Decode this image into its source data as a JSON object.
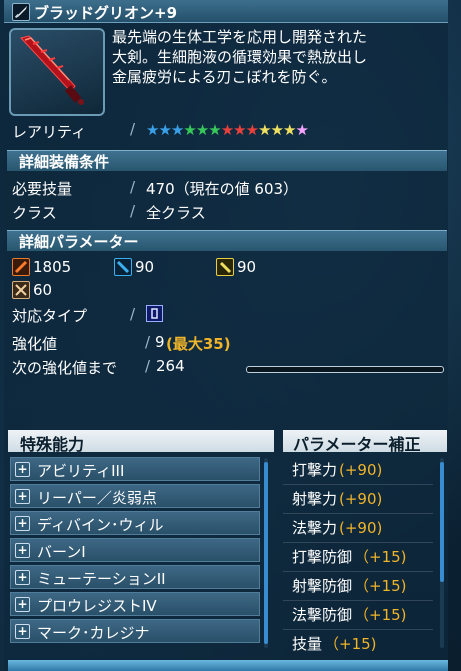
{
  "title": "ブラッドグリオン+9",
  "description": "最先端の生体工学を応用し開発された\n大剣。生細胞液の循環効果で熱放出し\n金属疲労による刃こぼれを防ぐ。",
  "rarity": {
    "label": "レアリティ",
    "stars": [
      {
        "char": "★",
        "color": "#3aa0e8"
      },
      {
        "char": "★",
        "color": "#3aa0e8"
      },
      {
        "char": "★",
        "color": "#3aa0e8"
      },
      {
        "char": "★",
        "color": "#38c85a"
      },
      {
        "char": "★",
        "color": "#38c85a"
      },
      {
        "char": "★",
        "color": "#38c85a"
      },
      {
        "char": "★",
        "color": "#e8403a"
      },
      {
        "char": "★",
        "color": "#e8403a"
      },
      {
        "char": "★",
        "color": "#e8403a"
      },
      {
        "char": "★",
        "color": "#f0e060"
      },
      {
        "char": "★",
        "color": "#f0e060"
      },
      {
        "char": "★",
        "color": "#f0e060"
      },
      {
        "char": "★",
        "color": "#f6a2ff"
      }
    ]
  },
  "equip_conditions": {
    "header": "詳細装備条件",
    "skill_label": "必要技量",
    "skill_value": "470（現在の値 603）",
    "class_label": "クラス",
    "class_value": "全クラス"
  },
  "parameters": {
    "header": "詳細パラメーター",
    "atk_melee": "1805",
    "atk_ranged": "90",
    "atk_tech": "90",
    "dex": "60",
    "type_label": "対応タイプ",
    "grind_label": "強化値",
    "grind_value": "9",
    "grind_max": "(最大35)",
    "next_label": "次の強化値まで",
    "next_value": "264",
    "next_progress_fraction": 0.0
  },
  "special_abilities": {
    "header": "特殊能力",
    "items": [
      "アビリティIII",
      "リーパー／炎弱点",
      "ディバイン･ウィル",
      "バーンI",
      "ミューテーションII",
      "プロウレジストIV",
      "マーク･カレジナ"
    ]
  },
  "parameter_bonus": {
    "header": "パラメーター補正",
    "items": [
      {
        "label": "打撃力",
        "value": "(+90)"
      },
      {
        "label": "射撃力",
        "value": "(+90)"
      },
      {
        "label": "法撃力",
        "value": "(+90)"
      },
      {
        "label": "打撃防御",
        "value": "（+15)"
      },
      {
        "label": "射撃防御",
        "value": "（+15)"
      },
      {
        "label": "法撃防御",
        "value": "（+15)"
      },
      {
        "label": "技量",
        "value": "（+15)"
      }
    ]
  },
  "colors": {
    "accent_gold": "#f0b429",
    "header_blue": "#3f7290"
  }
}
